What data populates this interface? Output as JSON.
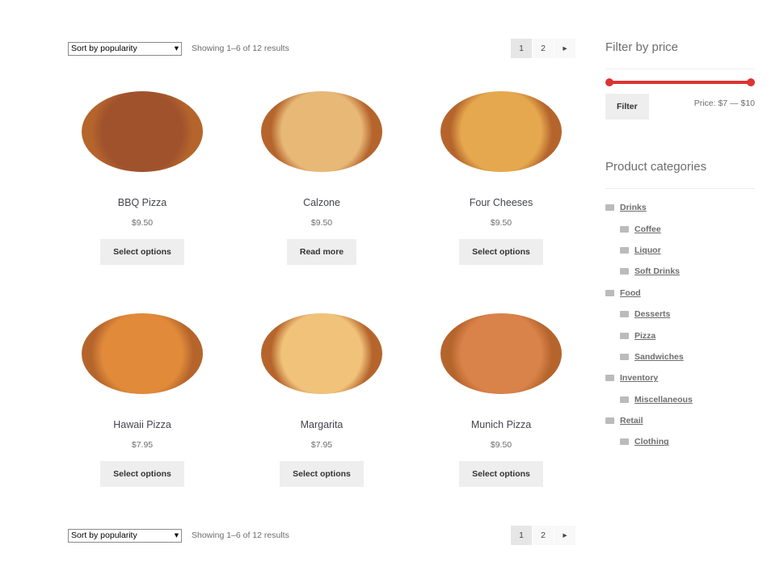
{
  "toolbar": {
    "sort": "Sort by popularity",
    "count": "Showing 1–6 of 12 results",
    "pages": [
      "1",
      "2"
    ],
    "next_icon": "triangle-right-icon"
  },
  "products": [
    {
      "name": "BBQ Pizza",
      "price": "$9.50",
      "button": "Select options",
      "color": "#a0522d"
    },
    {
      "name": "Calzone",
      "price": "$9.50",
      "button": "Read more",
      "color": "#e8b877"
    },
    {
      "name": "Four Cheeses",
      "price": "$9.50",
      "button": "Select options",
      "color": "#e6a84e"
    },
    {
      "name": "Hawaii Pizza",
      "price": "$7.95",
      "button": "Select options",
      "color": "#e08a3a"
    },
    {
      "name": "Margarita",
      "price": "$7.95",
      "button": "Select options",
      "color": "#f0c27a"
    },
    {
      "name": "Munich Pizza",
      "price": "$9.50",
      "button": "Select options",
      "color": "#d9824a"
    }
  ],
  "filter": {
    "title": "Filter by price",
    "button": "Filter",
    "price_label": "Price: $7 — $10",
    "min": 7,
    "max": 10,
    "accent": "#dd3333"
  },
  "categories": {
    "title": "Product categories",
    "items": [
      {
        "label": "Drinks",
        "level": 0
      },
      {
        "label": "Coffee",
        "level": 1
      },
      {
        "label": "Liquor",
        "level": 1
      },
      {
        "label": "Soft Drinks",
        "level": 1
      },
      {
        "label": "Food",
        "level": 0
      },
      {
        "label": "Desserts",
        "level": 1
      },
      {
        "label": "Pizza",
        "level": 1
      },
      {
        "label": "Sandwiches",
        "level": 1
      },
      {
        "label": "Inventory",
        "level": 0
      },
      {
        "label": "Miscellaneous",
        "level": 1
      },
      {
        "label": "Retail",
        "level": 0
      },
      {
        "label": "Clothing",
        "level": 1
      }
    ]
  }
}
